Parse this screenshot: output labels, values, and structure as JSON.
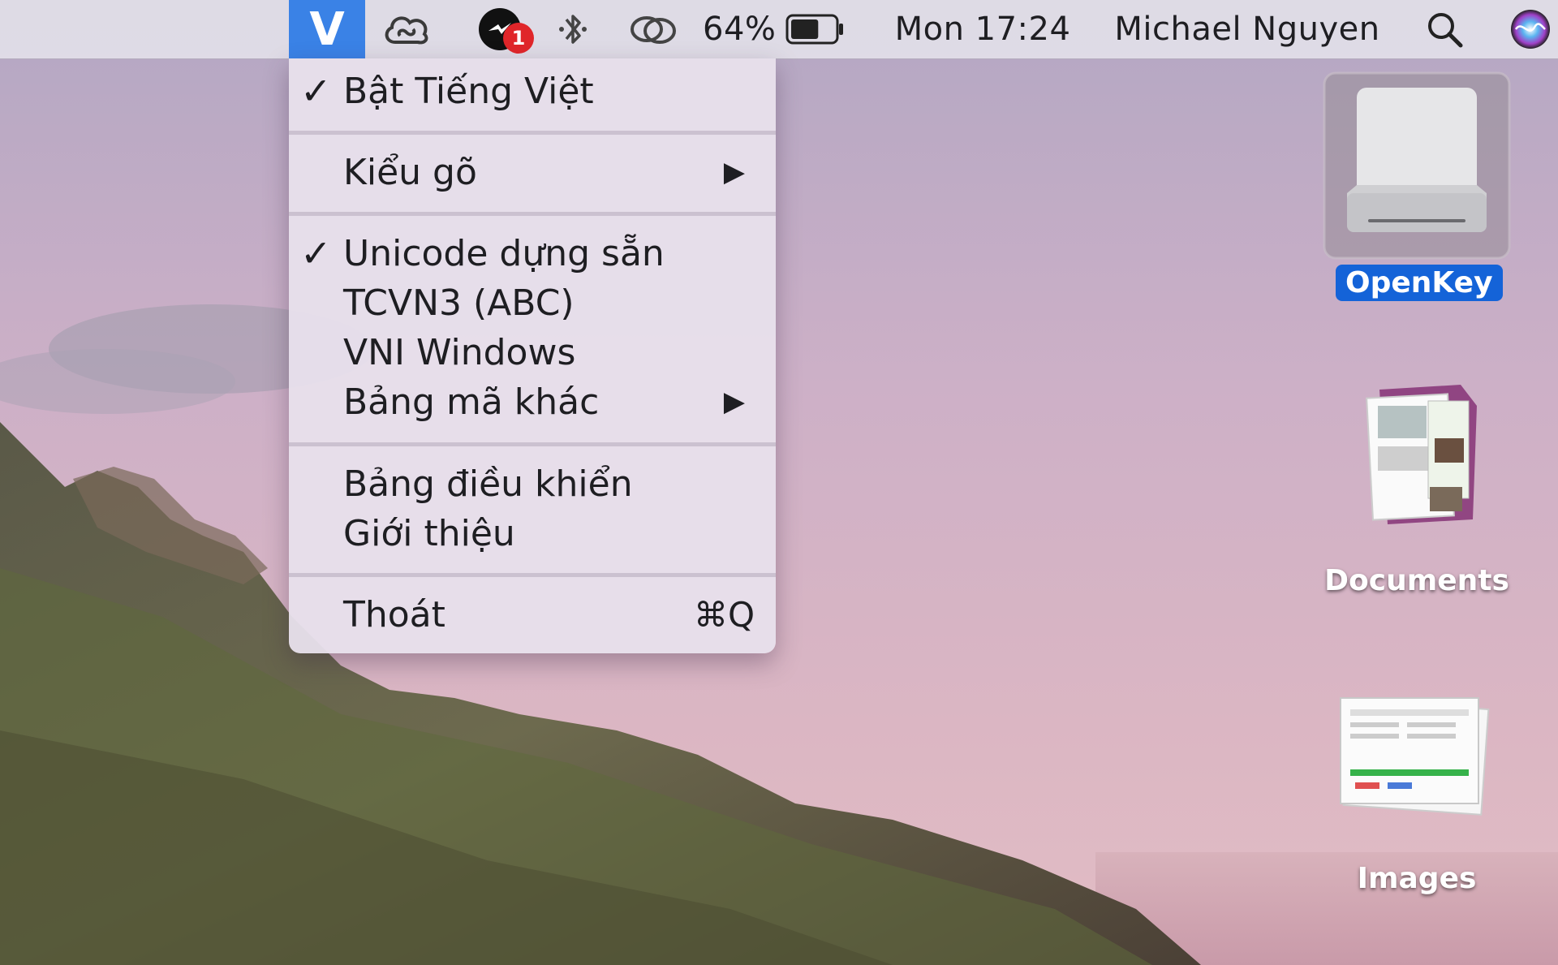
{
  "menubar": {
    "app_icon_label": "V",
    "notification_count": "1",
    "battery_percent": "64%",
    "battery_level": 0.64,
    "clock": "Mon 17:24",
    "user_name": "Michael Nguyen",
    "icons": [
      "creative-cloud-icon",
      "messenger-icon",
      "bluetooth-icon",
      "airplay-link-icon",
      "battery-icon",
      "search-icon",
      "siri-icon"
    ]
  },
  "menu": {
    "items": [
      {
        "label": "Bật Tiếng Việt",
        "checked": true
      },
      {
        "label": "Kiểu gõ",
        "submenu": true
      },
      {
        "label": "Unicode dựng sẵn",
        "checked": true
      },
      {
        "label": "TCVN3 (ABC)"
      },
      {
        "label": "VNI Windows"
      },
      {
        "label": "Bảng mã khác",
        "submenu": true
      },
      {
        "label": "Bảng điều khiển"
      },
      {
        "label": "Giới thiệu"
      },
      {
        "label": "Thoát",
        "shortcut": "⌘Q"
      }
    ],
    "check_glyph": "✓",
    "arrow_glyph": "▶"
  },
  "desktop": {
    "icons": [
      {
        "label": "OpenKey",
        "kind": "drive-icon",
        "selected": true
      },
      {
        "label": "Documents",
        "kind": "documents-icon"
      },
      {
        "label": "Images",
        "kind": "images-icon"
      }
    ]
  },
  "colors": {
    "accent": "#3a82e6",
    "selection": "#1463d8",
    "badge": "#e0262a"
  }
}
